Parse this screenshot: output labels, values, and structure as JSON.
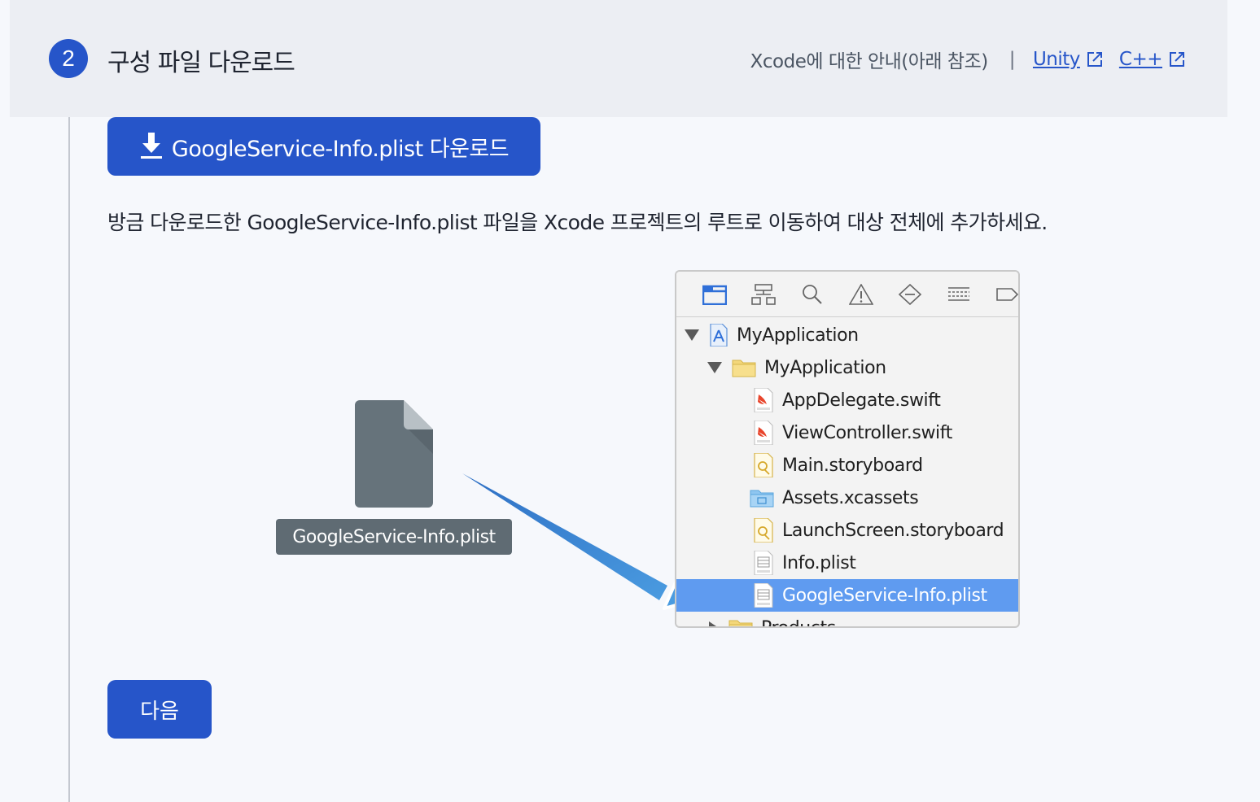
{
  "step": {
    "number": "2",
    "title": "구성 파일 다운로드"
  },
  "header_links": {
    "xcode_guide": "Xcode에 대한 안내(아래 참조)",
    "separator": "|",
    "unity": "Unity",
    "cpp": "C++"
  },
  "download_button": {
    "label": "GoogleService-Info.plist 다운로드"
  },
  "instruction": "방금 다운로드한 GoogleService-Info.plist 파일을 Xcode 프로젝트의 루트로 이동하여 대상 전체에 추가하세요.",
  "file": {
    "label": "GoogleService-Info.plist"
  },
  "xcode": {
    "toolbar_icons": [
      "folder-icon",
      "hierarchy-icon",
      "search-icon",
      "warning-icon",
      "breakpoint-icon",
      "list-icon",
      "tag-icon"
    ],
    "tree": [
      {
        "label": "MyApplication",
        "type": "project",
        "expanded": true
      },
      {
        "label": "MyApplication",
        "type": "folder",
        "expanded": true
      },
      {
        "label": "AppDelegate.swift",
        "type": "swift"
      },
      {
        "label": "ViewController.swift",
        "type": "swift"
      },
      {
        "label": "Main.storyboard",
        "type": "storyboard"
      },
      {
        "label": "Assets.xcassets",
        "type": "assets"
      },
      {
        "label": "LaunchScreen.storyboard",
        "type": "storyboard"
      },
      {
        "label": "Info.plist",
        "type": "plist"
      },
      {
        "label": "GoogleService-Info.plist",
        "type": "plist",
        "selected": true
      },
      {
        "label": "Products",
        "type": "folder",
        "expanded": false
      }
    ],
    "selection_color": "#5f9bf0"
  },
  "next_button": {
    "label": "다음"
  },
  "colors": {
    "primary": "#2655c9",
    "header_bg": "#eceef3",
    "page_bg": "#f6f8fc",
    "arrow": "#4a90dc"
  }
}
